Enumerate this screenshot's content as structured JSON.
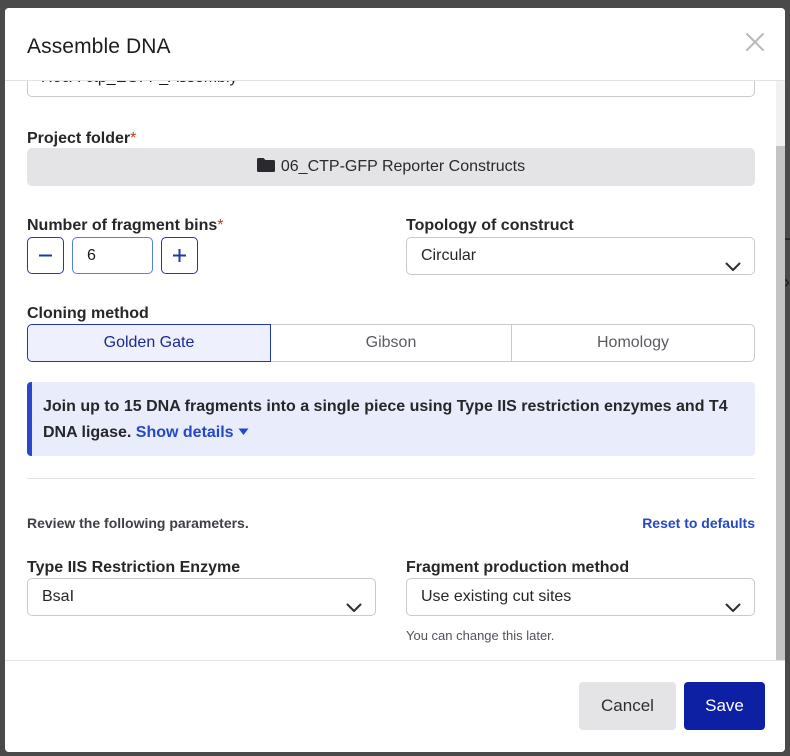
{
  "dialog": {
    "title": "Assemble DNA"
  },
  "name_field": {
    "value": "RecA-ctp_EGFP_Assembly"
  },
  "project_folder": {
    "label": "Project folder",
    "required_mark": "*",
    "value": "06_CTP-GFP Reporter Constructs"
  },
  "fragment_bins": {
    "label": "Number of fragment bins",
    "required_mark": "*",
    "value": "6"
  },
  "topology": {
    "label": "Topology of construct",
    "value": "Circular"
  },
  "cloning_method": {
    "label": "Cloning method",
    "options": [
      "Golden Gate",
      "Gibson",
      "Homology"
    ],
    "selected": "Golden Gate"
  },
  "info_box": {
    "text": "Join up to 15 DNA fragments into a single piece using Type IIS restriction enzymes and T4 DNA ligase.",
    "link": "Show details"
  },
  "parameters": {
    "review_text": "Review the following parameters.",
    "reset_link": "Reset to defaults"
  },
  "enzyme": {
    "label": "Type IIS Restriction Enzyme",
    "value": "BsaI"
  },
  "fragment_production": {
    "label": "Fragment production method",
    "value": "Use existing cut sites",
    "hint": "You can change this later."
  },
  "footer": {
    "cancel_label": "Cancel",
    "save_label": "Save"
  },
  "colors": {
    "primary": "#0d1fa3",
    "link": "#2548c8",
    "info_bg": "#e9ecfb",
    "required": "#c0392b"
  },
  "icons": {
    "close": "close-icon",
    "folder": "folder-icon",
    "minus": "minus-icon",
    "plus": "plus-icon",
    "chevron": "chevron-down-icon",
    "caret": "caret-down-icon"
  }
}
